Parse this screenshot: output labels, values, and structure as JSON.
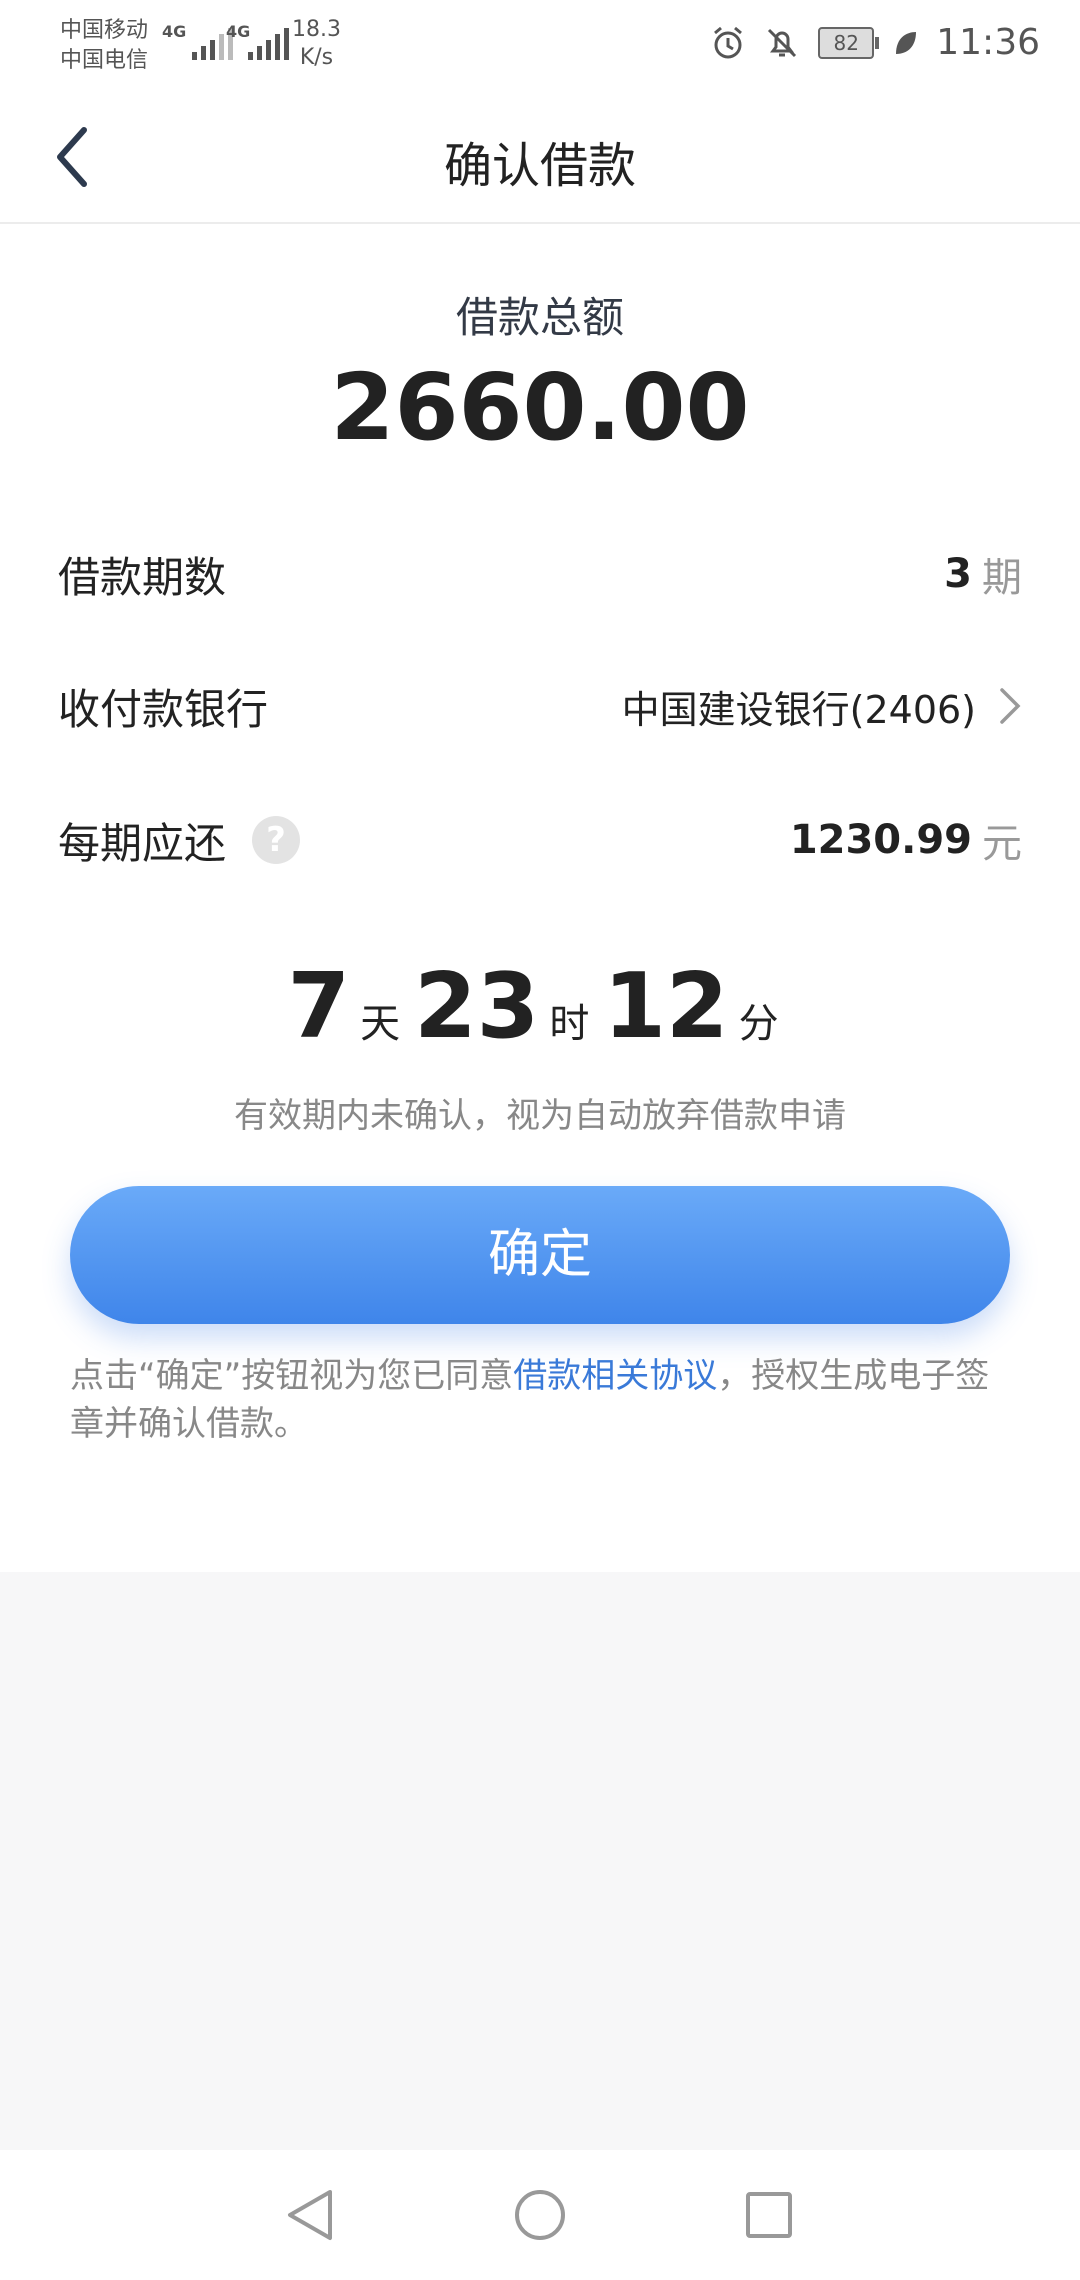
{
  "status_bar": {
    "carrier1": "中国移动",
    "carrier2": "中国电信",
    "net1": "4G",
    "net2": "4G",
    "speed_value": "18.3",
    "speed_unit": "K/s",
    "battery": "82",
    "time": "11:36"
  },
  "nav": {
    "title": "确认借款"
  },
  "loan": {
    "total_label": "借款总额",
    "total_amount": "2660.00",
    "term_label": "借款期数",
    "term_value": "3",
    "term_unit": "期",
    "bank_label": "收付款银行",
    "bank_value": "中国建设银行(2406)",
    "installment_label": "每期应还",
    "installment_value": "1230.99",
    "installment_unit": "元"
  },
  "countdown": {
    "days": "7",
    "days_unit": "天",
    "hours": "23",
    "hours_unit": "时",
    "minutes": "12",
    "minutes_unit": "分"
  },
  "hint": "有效期内未确认，视为自动放弃借款申请",
  "confirm_label": "确定",
  "agreement": {
    "prefix": "点击“确定”按钮视为您已同意",
    "link": "借款相关协议",
    "suffix": "，授权生成电子签章并确认借款。"
  },
  "colors": {
    "accent": "#4a8ff0",
    "link": "#3a7ad8"
  }
}
